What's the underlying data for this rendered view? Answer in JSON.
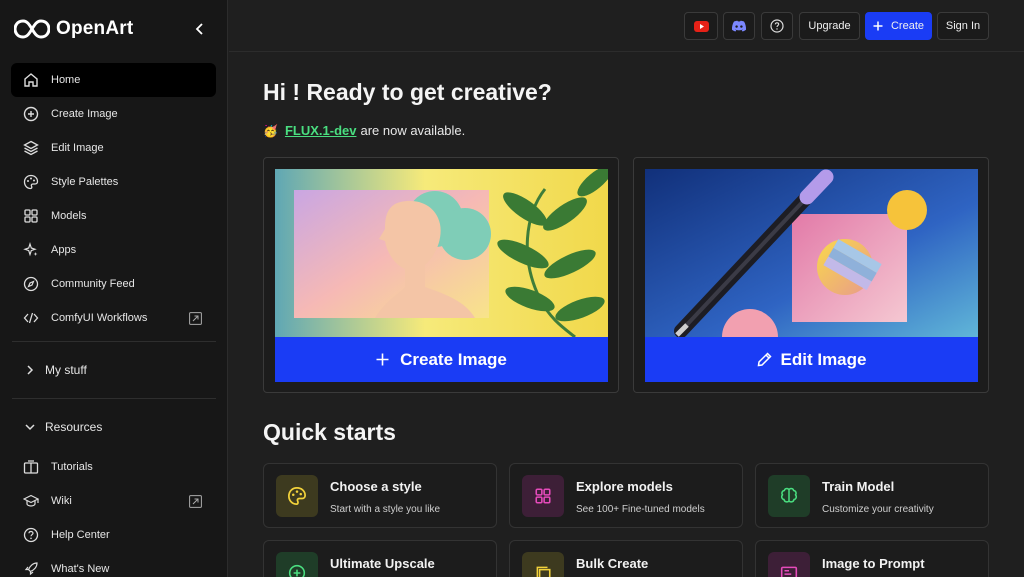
{
  "app": {
    "name": "OpenArt"
  },
  "sidebar": {
    "nav": [
      {
        "label": "Home",
        "icon": "home-icon",
        "active": true
      },
      {
        "label": "Create Image",
        "icon": "plus-circle-icon"
      },
      {
        "label": "Edit Image",
        "icon": "layers-icon"
      },
      {
        "label": "Style Palettes",
        "icon": "palette-icon"
      },
      {
        "label": "Models",
        "icon": "grid-icon"
      },
      {
        "label": "Apps",
        "icon": "apps-sparkle-icon"
      },
      {
        "label": "Community Feed",
        "icon": "compass-icon"
      },
      {
        "label": "ComfyUI Workflows",
        "icon": "code-icon",
        "external": true
      }
    ],
    "my_stuff": "My stuff",
    "resources": "Resources",
    "resource_items": [
      {
        "label": "Tutorials",
        "icon": "tutorial-icon"
      },
      {
        "label": "Wiki",
        "icon": "graduation-cap-icon",
        "external": true
      },
      {
        "label": "Help Center",
        "icon": "help-circle-icon"
      },
      {
        "label": "What's New",
        "icon": "rocket-icon"
      }
    ]
  },
  "topbar": {
    "youtube_icon": "youtube-icon",
    "discord_icon": "discord-icon",
    "help_icon": "help-icon",
    "upgrade": "Upgrade",
    "create": "Create",
    "sign_in": "Sign In"
  },
  "main": {
    "greeting": "Hi ! Ready to get creative?",
    "announcement": {
      "emoji": "🥳",
      "link": "FLUX.1-dev",
      "text": "are now available."
    },
    "hero_cards": [
      {
        "cta": "Create Image",
        "icon": "plus-icon"
      },
      {
        "cta": "Edit Image",
        "icon": "pencil-icon"
      }
    ],
    "quick_starts_title": "Quick starts",
    "quick_starts": [
      {
        "title": "Choose a style",
        "desc": "Start with a style you like",
        "icon": "palette-icon",
        "color": "#f2d23b",
        "bg": "#3d3a1f"
      },
      {
        "title": "Explore models",
        "desc": "See 100+ Fine-tuned models",
        "icon": "grid-icon",
        "color": "#e64bbb",
        "bg": "#3d1f37"
      },
      {
        "title": "Train Model",
        "desc": "Customize your creativity",
        "icon": "brain-icon",
        "color": "#4ade80",
        "bg": "#1f3d28"
      },
      {
        "title": "Ultimate Upscale",
        "desc": "",
        "icon": "upscale-icon",
        "color": "#4ade80",
        "bg": "#1f3d28"
      },
      {
        "title": "Bulk Create",
        "desc": "",
        "icon": "stack-icon",
        "color": "#f2d23b",
        "bg": "#3d3a1f"
      },
      {
        "title": "Image to Prompt",
        "desc": "",
        "icon": "image-prompt-icon",
        "color": "#e64bbb",
        "bg": "#3d1f37"
      }
    ]
  },
  "colors": {
    "accent": "#1a3cf5",
    "link": "#4ade80",
    "sidebar_bg": "#171717",
    "main_bg": "#1f1f1f"
  }
}
